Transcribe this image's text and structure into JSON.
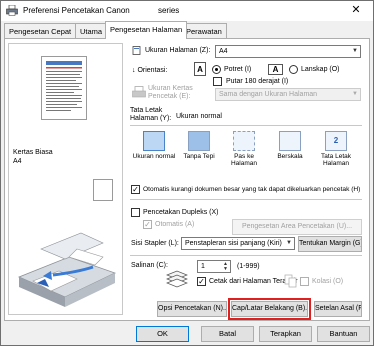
{
  "window": {
    "title": "Preferensi Pencetakan Canon ",
    "title_suffix": "series"
  },
  "tabs": [
    {
      "label": "Pengesetan Cepat"
    },
    {
      "label": "Utama"
    },
    {
      "label": "Pengesetan Halaman"
    },
    {
      "label": "Perawatan"
    }
  ],
  "preview": {
    "media_label": "Kertas Biasa",
    "size_label": "A4"
  },
  "page_size": {
    "label": "Ukuran Halaman (Z):",
    "value": "A4"
  },
  "orientation": {
    "label": "Orientasi:",
    "portrait": "Potret (I)",
    "landscape": "Lanskap (O)",
    "rotate": "Putar 180 derajat (I)",
    "selected": "portrait"
  },
  "printer_paper_size": {
    "label_line1": "Ukuran Kertas",
    "label_line2": "Pencetak (E):",
    "value": "Sama dengan Ukuran Halaman"
  },
  "page_layout": {
    "label_line1": "Tata Letak",
    "label_line2": "Halaman (Y):",
    "current": "Ukuran normal",
    "items": [
      {
        "label": "Ukuran normal"
      },
      {
        "label": "Tanpa Tepi"
      },
      {
        "label": "Pas ke Halaman"
      },
      {
        "label": "Berskala"
      },
      {
        "label": "Tata Letak Halaman"
      }
    ]
  },
  "auto_reduce": {
    "label": "Otomatis kurangi dokumen besar yang tak dapat dikeluarkan pencetak (H)",
    "checked": true
  },
  "duplex": {
    "label": "Pencetakan Dupleks (X)",
    "auto_label": "Otomatis (A)",
    "area_button": "Pengesetan Area Pencetakan (U)..."
  },
  "stapling": {
    "label": "Sisi Stapler (L):",
    "value": "Penstapleran sisi panjang (Kiri)",
    "margin_button": "Tentukan Margin (G)..."
  },
  "copies": {
    "label": "Salinan (C):",
    "value": "1",
    "range": "(1-999)",
    "last_page_first": "Cetak dari Halaman Terakhir (R)",
    "collate": "Kolasi (O)"
  },
  "buttons": {
    "print_options": "Opsi Pencetakan (N)...",
    "stamp_background": "Cap/Latar Belakang (B)...",
    "defaults": "Setelan Asal (F)",
    "ok": "OK",
    "cancel": "Batal",
    "apply": "Terapkan",
    "help": "Bantuan"
  },
  "colors": {
    "highlight": "#e02020",
    "window_bg": "#f0f0f0",
    "selected_layout": "#bcd7f3"
  },
  "icons": [
    "printer-app-icon",
    "close-icon",
    "portrait-icon",
    "landscape-icon",
    "printer-illustration",
    "copies-stack-icon",
    "collate-icon"
  ]
}
